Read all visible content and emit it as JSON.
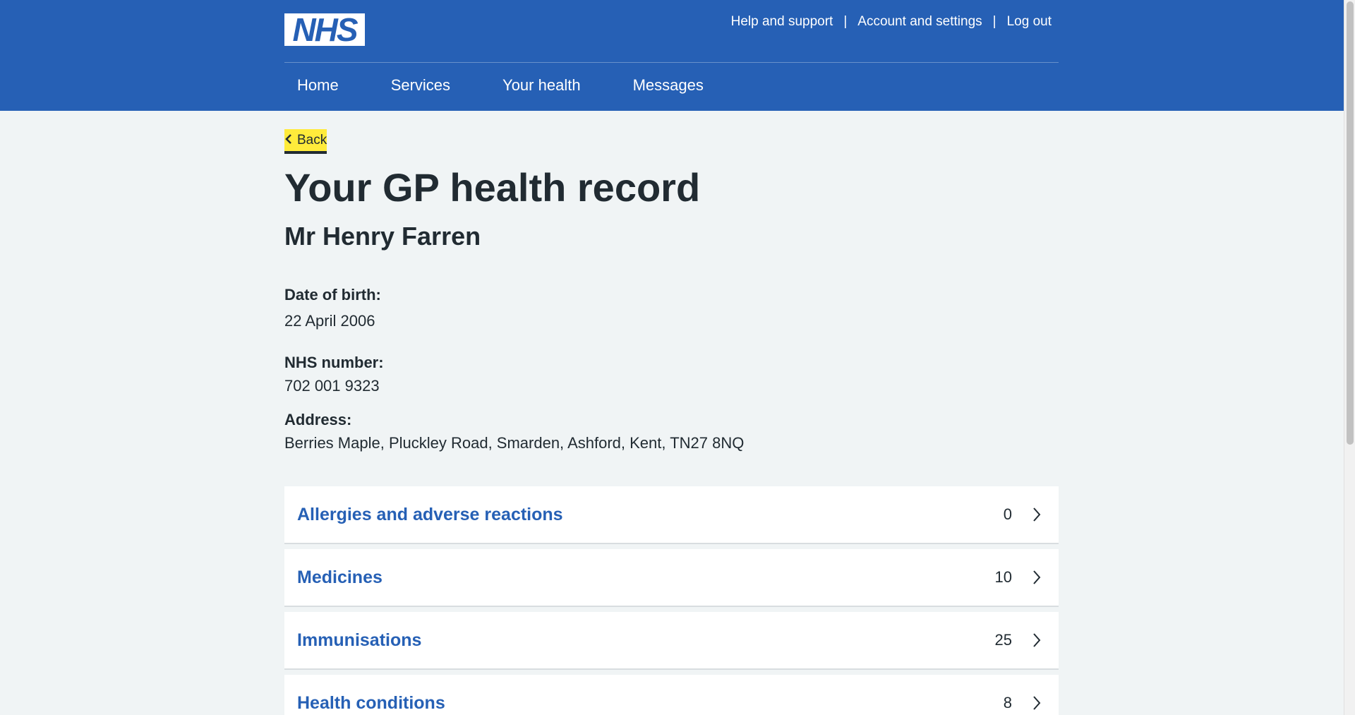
{
  "header": {
    "logo_text": "NHS",
    "utility_links": {
      "help": "Help and support",
      "separator": "|",
      "account": "Account and settings",
      "logout": "Log out"
    },
    "nav": {
      "home": "Home",
      "services": "Services",
      "your_health": "Your health",
      "messages": "Messages"
    }
  },
  "back": {
    "label": "Back"
  },
  "page": {
    "title": "Your GP health record",
    "patient_name": "Mr Henry Farren"
  },
  "details": {
    "dob_label": "Date of birth:",
    "dob_value": "22 April 2006",
    "nhs_label": "NHS number:",
    "nhs_value": "702 001 9323",
    "address_label": "Address:",
    "address_value": "Berries Maple, Pluckley Road, Smarden, Ashford, Kent, TN27 8NQ"
  },
  "records": [
    {
      "title": "Allergies and adverse reactions",
      "count": "0"
    },
    {
      "title": "Medicines",
      "count": "10"
    },
    {
      "title": "Immunisations",
      "count": "25"
    },
    {
      "title": "Health conditions",
      "count": "8"
    }
  ],
  "colors": {
    "nhs_blue": "#2660b5",
    "background": "#f0f4f5",
    "text": "#212b32",
    "focus_yellow": "#ffeb3b"
  }
}
